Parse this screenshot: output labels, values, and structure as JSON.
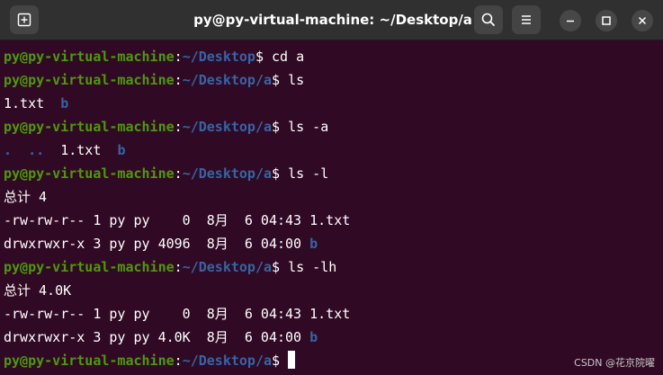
{
  "window": {
    "title": "py@py-virtual-machine: ~/Desktop/a"
  },
  "titlebar": {
    "icons": [
      "new-tab-icon",
      "search-icon",
      "hamburger-menu-icon",
      "minimize-icon",
      "maximize-icon",
      "close-icon"
    ]
  },
  "terminal": {
    "lines": [
      {
        "type": "prompt",
        "user": "py@py-virtual-machine",
        "sep": ":",
        "path": "~/Desktop",
        "sigil": "$ ",
        "cmd": "cd a"
      },
      {
        "type": "prompt",
        "user": "py@py-virtual-machine",
        "sep": ":",
        "path": "~/Desktop/a",
        "sigil": "$ ",
        "cmd": "ls"
      },
      {
        "type": "output",
        "parts": [
          {
            "t": "1.txt",
            "c": "plain"
          },
          {
            "t": "  ",
            "c": "plain"
          },
          {
            "t": "b",
            "c": "dir"
          }
        ]
      },
      {
        "type": "prompt",
        "user": "py@py-virtual-machine",
        "sep": ":",
        "path": "~/Desktop/a",
        "sigil": "$ ",
        "cmd": "ls -a"
      },
      {
        "type": "output",
        "parts": [
          {
            "t": ".",
            "c": "dir"
          },
          {
            "t": "  ",
            "c": "plain"
          },
          {
            "t": "..",
            "c": "dir"
          },
          {
            "t": "  ",
            "c": "plain"
          },
          {
            "t": "1.txt",
            "c": "plain"
          },
          {
            "t": "  ",
            "c": "plain"
          },
          {
            "t": "b",
            "c": "dir"
          }
        ]
      },
      {
        "type": "prompt",
        "user": "py@py-virtual-machine",
        "sep": ":",
        "path": "~/Desktop/a",
        "sigil": "$ ",
        "cmd": "ls -l"
      },
      {
        "type": "output",
        "parts": [
          {
            "t": "总计 4",
            "c": "plain"
          }
        ]
      },
      {
        "type": "output",
        "parts": [
          {
            "t": "-rw-rw-r-- 1 py py    0  8月  6 04:43 1.txt",
            "c": "plain"
          }
        ]
      },
      {
        "type": "output",
        "parts": [
          {
            "t": "drwxrwxr-x 3 py py 4096  8月  6 04:00 ",
            "c": "plain"
          },
          {
            "t": "b",
            "c": "dir"
          }
        ]
      },
      {
        "type": "prompt",
        "user": "py@py-virtual-machine",
        "sep": ":",
        "path": "~/Desktop/a",
        "sigil": "$ ",
        "cmd": "ls -lh"
      },
      {
        "type": "output",
        "parts": [
          {
            "t": "总计 4.0K",
            "c": "plain"
          }
        ]
      },
      {
        "type": "output",
        "parts": [
          {
            "t": "-rw-rw-r-- 1 py py    0  8月  6 04:43 1.txt",
            "c": "plain"
          }
        ]
      },
      {
        "type": "output",
        "parts": [
          {
            "t": "drwxrwxr-x 3 py py 4.0K  8月  6 04:00 ",
            "c": "plain"
          },
          {
            "t": "b",
            "c": "dir"
          }
        ]
      },
      {
        "type": "prompt",
        "user": "py@py-virtual-machine",
        "sep": ":",
        "path": "~/Desktop/a",
        "sigil": "$ ",
        "cmd": "",
        "cursor": true
      }
    ]
  },
  "watermark": "CSDN @花京院曜",
  "colors": {
    "background": "#300a24",
    "titlebar": "#303030",
    "prompt_user": "#4e9a06",
    "prompt_path": "#3465a4",
    "directory": "#3465a4",
    "text": "#ffffff"
  }
}
